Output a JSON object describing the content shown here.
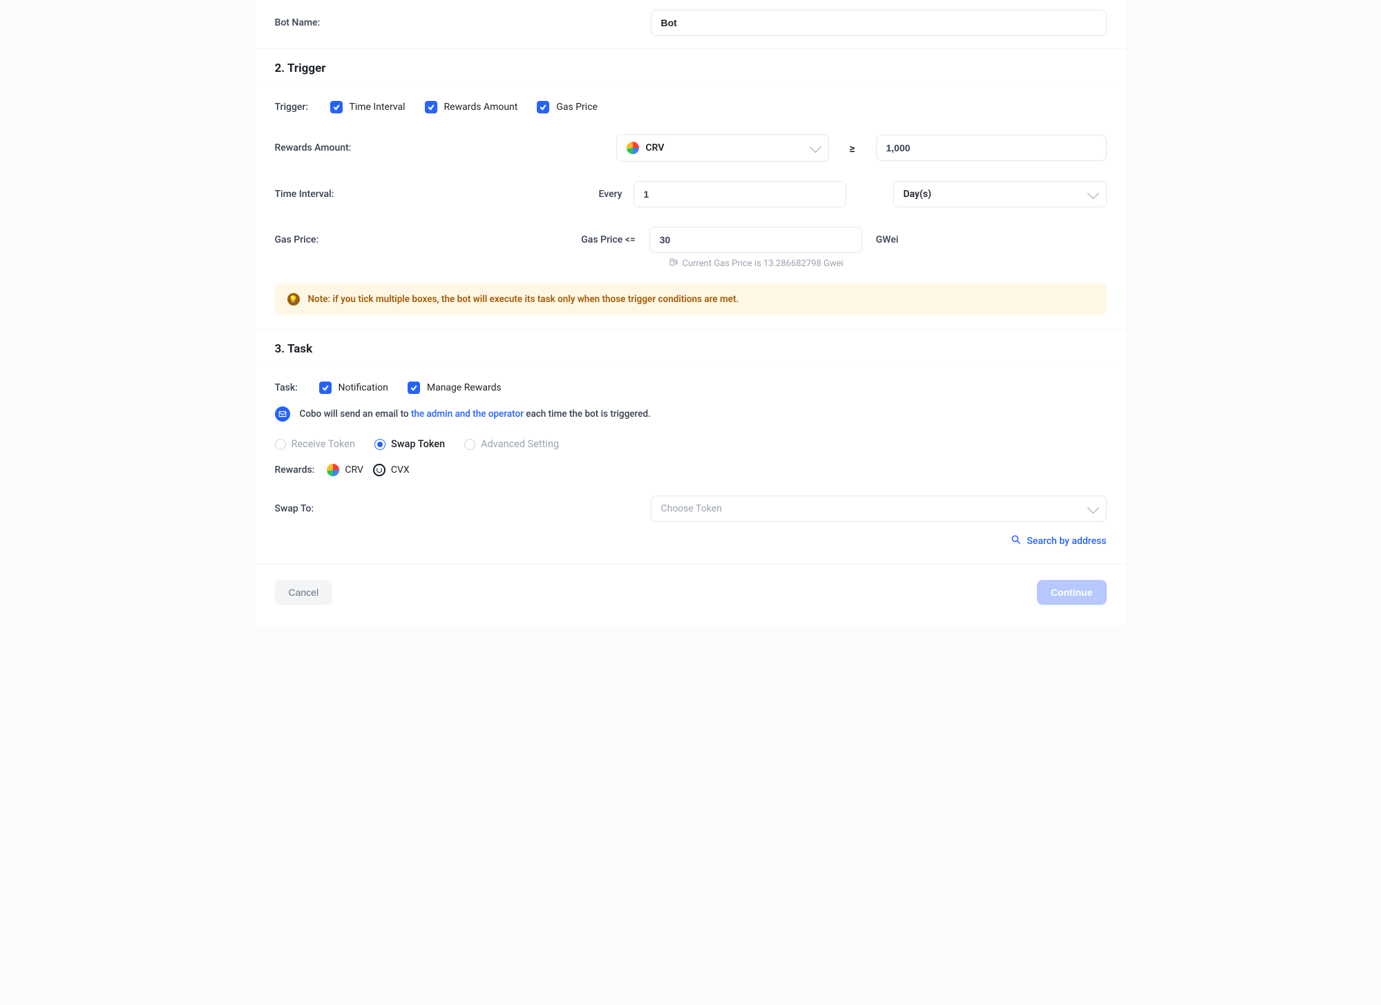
{
  "botName": {
    "label": "Bot Name:",
    "value": "Bot"
  },
  "trigger": {
    "sectionTitle": "2. Trigger",
    "label": "Trigger:",
    "options": {
      "timeInterval": "Time Interval",
      "rewardsAmount": "Rewards Amount",
      "gasPrice": "Gas Price"
    },
    "rewardsAmount": {
      "label": "Rewards Amount:",
      "token": "CRV",
      "operator": "≥",
      "value": "1,000"
    },
    "timeInterval": {
      "label": "Time Interval:",
      "prefix": "Every",
      "value": "1",
      "unit": "Day(s)"
    },
    "gasPrice": {
      "label": "Gas Price:",
      "prefix": "Gas Price <=",
      "value": "30",
      "unit": "GWei",
      "hint": "Current Gas Price is 13.286682798 Gwei"
    },
    "note": "Note: if you tick multiple boxes, the bot will execute its task only when those trigger conditions are met."
  },
  "task": {
    "sectionTitle": "3. Task",
    "label": "Task:",
    "options": {
      "notification": "Notification",
      "manageRewards": "Manage Rewards"
    },
    "emailInfo": {
      "pre": "Cobo will send an email to ",
      "link": "the admin and the operator",
      "post": " each time the bot is triggered."
    },
    "modes": {
      "receiveToken": "Receive Token",
      "swapToken": "Swap Token",
      "advancedSetting": "Advanced Setting"
    },
    "rewards": {
      "label": "Rewards:",
      "tokens": [
        "CRV",
        "CVX"
      ]
    },
    "swapTo": {
      "label": "Swap To:",
      "placeholder": "Choose Token"
    },
    "searchLink": "Search by address"
  },
  "footer": {
    "cancel": "Cancel",
    "continue": "Continue"
  }
}
